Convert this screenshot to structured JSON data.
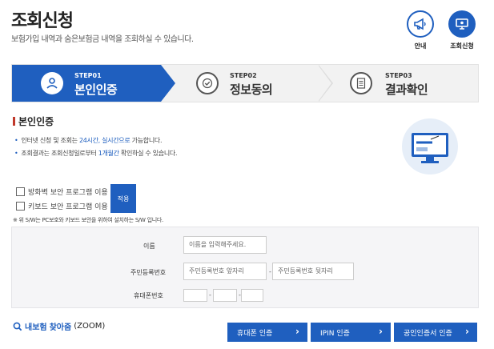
{
  "header": {
    "title": "조회신청",
    "subtitle": "보험가입 내역과 숨은보험금 내역을 조회하실 수 있습니다."
  },
  "top_buttons": [
    {
      "label": "안내",
      "icon": "megaphone-icon"
    },
    {
      "label": "조회신청",
      "icon": "monitor-icon"
    }
  ],
  "steps": [
    {
      "num": "STEP01",
      "name": "본인인증",
      "active": true,
      "icon": "person-icon"
    },
    {
      "num": "STEP02",
      "name": "정보동의",
      "active": false,
      "icon": "check-circle-icon"
    },
    {
      "num": "STEP03",
      "name": "결과확인",
      "active": false,
      "icon": "document-icon"
    }
  ],
  "section": {
    "title": "본인인증",
    "notice1_a": "인터넷 신청 및 조회는 ",
    "notice1_b": "24시간, 실시간으로",
    "notice1_c": " 가능합니다.",
    "notice2_a": "조회결과는 조회신청일로부터 ",
    "notice2_b": "1개월간",
    "notice2_c": " 확인하실 수 있습니다."
  },
  "security": {
    "firewall_label": "방화벽 보안 프로그램 이용",
    "keyboard_label": "키보드 보안 프로그램 이용",
    "apply_label": "적용",
    "note": "※ 위 S/W는 PC보호와 키보드 보안을 위하여 설치하는 S/W 입니다."
  },
  "form": {
    "name_label": "이름",
    "name_placeholder": "이름을 입력해주세요.",
    "rrn_label": "주민등록번호",
    "rrn_front_placeholder": "주민등록번호 앞자리",
    "rrn_back_placeholder": "주민등록번호 뒷자리",
    "phone_label": "휴대폰번호",
    "dash": "-"
  },
  "footer": {
    "search_prefix": "내보험",
    "search_highlight": "찾아줌",
    "search_suffix": "(ZOOM)",
    "buttons": [
      {
        "label": "휴대폰 인증"
      },
      {
        "label": "IPIN 인증"
      },
      {
        "label": "공인인증서 인증"
      }
    ],
    "chevron": "›"
  },
  "colors": {
    "primary": "#1f5fbf",
    "accent_red": "#c0392b",
    "form_bg": "#f5f5f7"
  }
}
